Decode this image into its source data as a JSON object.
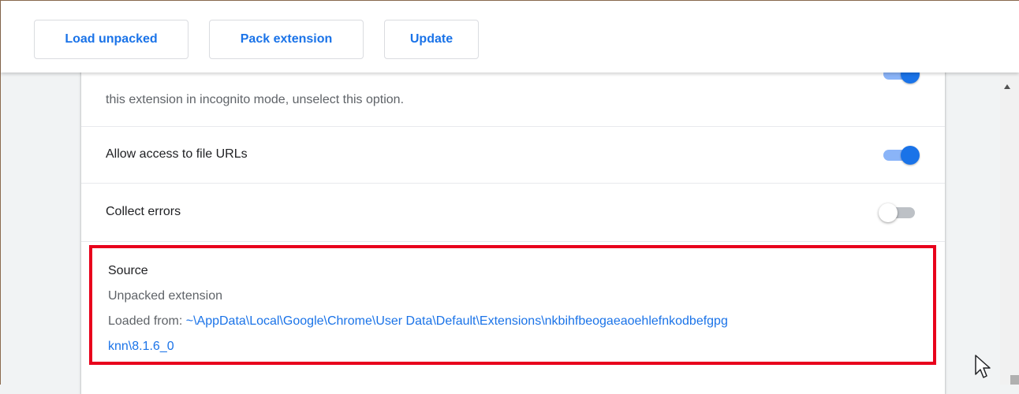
{
  "toolbar": {
    "load_unpacked": "Load unpacked",
    "pack_extension": "Pack extension",
    "update": "Update"
  },
  "details": {
    "incognito_warning_line2": "this extension in incognito mode, unselect this option.",
    "incognito_toggle_on": true,
    "file_urls_label": "Allow access to file URLs",
    "file_urls_toggle_on": true,
    "collect_errors_label": "Collect errors",
    "collect_errors_toggle_on": false
  },
  "source": {
    "title": "Source",
    "type": "Unpacked extension",
    "loaded_from_label": "Loaded from: ",
    "path_line1": "~\\AppData\\Local\\Google\\Chrome\\User Data\\Default\\Extensions\\nkbihfbeogaeaoehlefnkodbefgpg",
    "path_line2": "knn\\8.1.6_0"
  },
  "colors": {
    "accent": "#1a73e8",
    "highlight_border": "#e8001c",
    "toggle_track_on": "#8ab4f8"
  }
}
